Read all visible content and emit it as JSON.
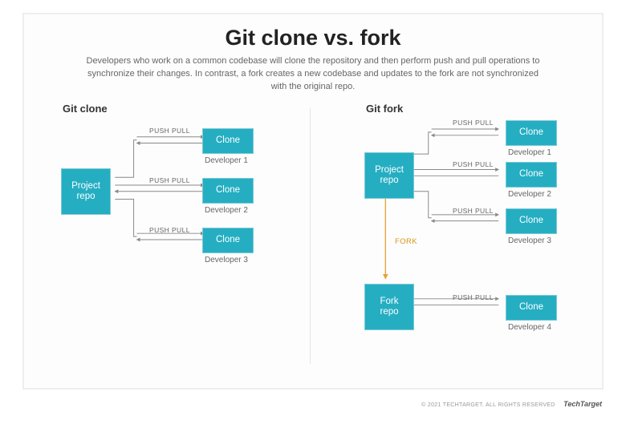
{
  "header": {
    "title": "Git clone vs. fork",
    "subtitle": "Developers who work on a common codebase will clone the repository and then perform push and pull operations to synchronize their changes. In contrast, a fork creates a new codebase and updates to the fork are not synchronized with the original repo."
  },
  "left": {
    "section": "Git clone",
    "repo": "Project\nrepo",
    "clone_label": "Clone",
    "push_pull": "PUSH PULL",
    "devs": [
      "Developer 1",
      "Developer 2",
      "Developer 3"
    ]
  },
  "right": {
    "section": "Git fork",
    "project_repo": "Project\nrepo",
    "fork_repo": "Fork\nrepo",
    "clone_label": "Clone",
    "push_pull": "PUSH PULL",
    "fork_label": "FORK",
    "devs": [
      "Developer 1",
      "Developer 2",
      "Developer 3",
      "Developer 4"
    ]
  },
  "footer": {
    "copyright": "© 2021 TECHTARGET. ALL RIGHTS RESERVED",
    "brand": "TechTarget"
  },
  "colors": {
    "box": "#25aec2",
    "box_border": "#7bc9d6",
    "fork_line": "#e6a23c"
  }
}
